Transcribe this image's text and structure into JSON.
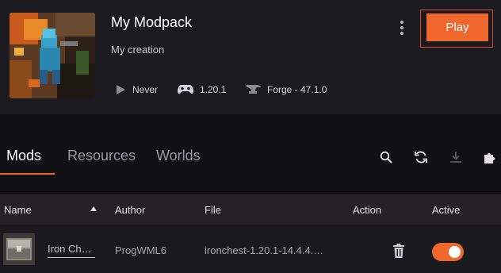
{
  "header": {
    "title": "My Modpack",
    "subtitle": "My creation",
    "last_played": "Never",
    "game_version": "1.20.1",
    "loader": "Forge - 47.1.0",
    "play_label": "Play",
    "thumbnail_icon": "modpack-thumbnail",
    "menu_icon": "kebab-menu-icon"
  },
  "tabs": [
    {
      "label": "Mods",
      "active": true
    },
    {
      "label": "Resources",
      "active": false
    },
    {
      "label": "Worlds",
      "active": false
    }
  ],
  "toolbar_icons": [
    "search-icon",
    "refresh-icon",
    "download-icon",
    "puzzle-icon"
  ],
  "table": {
    "columns": [
      "Name",
      "Author",
      "File",
      "Action",
      "Active"
    ],
    "sort_column": "Name",
    "sort_direction": "asc",
    "rows": [
      {
        "name": "Iron Ch…",
        "author": "ProgWML6",
        "file": "ironchest-1.20.1-14.4.4.…",
        "active": true
      }
    ]
  },
  "colors": {
    "accent": "#f0672e",
    "background": "#111014",
    "header_bg": "#1b1a1f",
    "table_header_bg": "#242228",
    "row_bg": "#1a191e"
  }
}
